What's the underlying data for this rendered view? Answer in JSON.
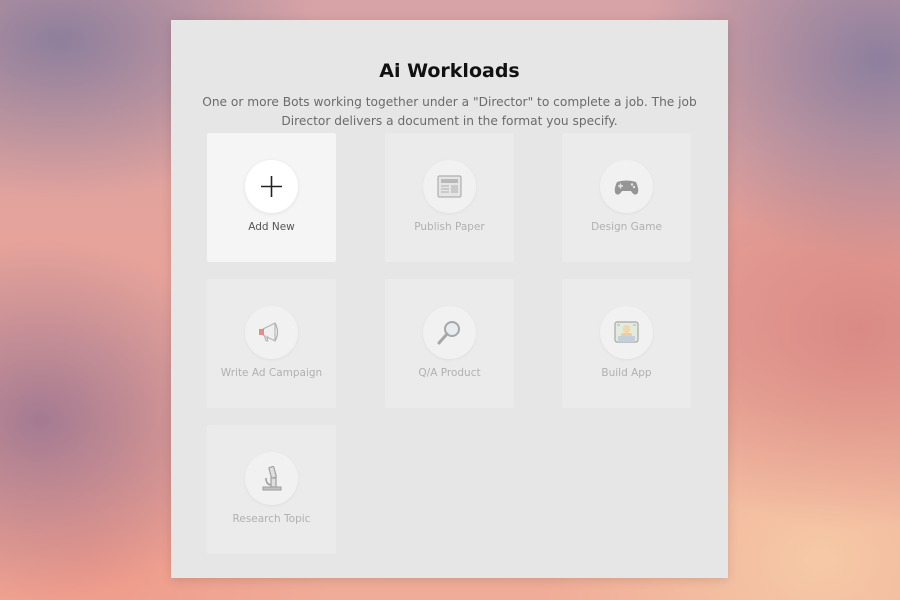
{
  "panel": {
    "title": "Ai Workloads",
    "subtitle": "One or more Bots working together under a \"Director\" to complete a job. The job Director delivers a document in the format you specify."
  },
  "cards": [
    {
      "label": "Add New",
      "icon": "plus-icon"
    },
    {
      "label": "Publish Paper",
      "icon": "newspaper-icon"
    },
    {
      "label": "Design Game",
      "icon": "game-controller-icon"
    },
    {
      "label": "Write Ad Campaign",
      "icon": "megaphone-icon"
    },
    {
      "label": "Q/A Product",
      "icon": "magnifying-glass-icon"
    },
    {
      "label": "Build App",
      "icon": "developer-laptop-icon"
    },
    {
      "label": "Research Topic",
      "icon": "microscope-icon"
    }
  ]
}
